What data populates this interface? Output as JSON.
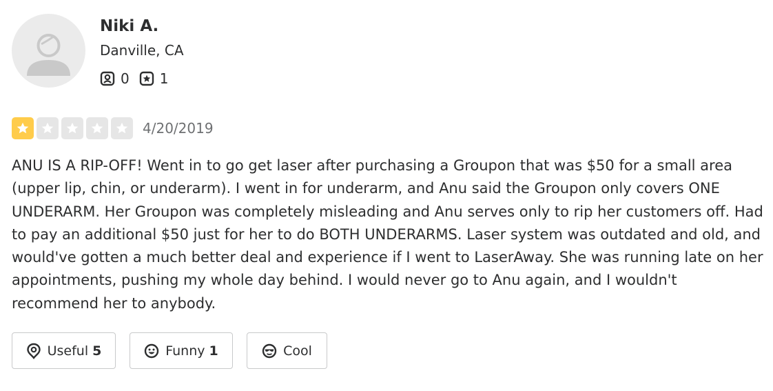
{
  "user": {
    "name": "Niki A.",
    "location": "Danville, CA",
    "friends_count": "0",
    "reviews_count": "1",
    "avatar_icon": "default-user-avatar-icon"
  },
  "review": {
    "rating": 1,
    "rating_max": 5,
    "date": "4/20/2019",
    "text": "ANU IS A RIP-OFF! Went in to go get laser after purchasing a Groupon that was $50 for a small area (upper lip, chin, or underarm). I went in for underarm, and Anu said the Groupon only covers ONE UNDERARM. Her Groupon was completely misleading and Anu serves only to rip her customers off. Had to pay an additional $50 just for her to do BOTH UNDERARMS. Laser system was outdated and old, and would've gotten a much better deal and experience if I went to LaserAway. She was running late on her appointments, pushing my whole day behind. I would never go to Anu again, and I wouldn't recommend her to anybody."
  },
  "actions": {
    "useful": {
      "label": "Useful",
      "count": "5",
      "icon": "lightbulb-icon"
    },
    "funny": {
      "label": "Funny",
      "count": "1",
      "icon": "smiley-icon"
    },
    "cool": {
      "label": "Cool",
      "count": "",
      "icon": "sunglasses-icon"
    }
  },
  "colors": {
    "star_on": "#ffcc4b",
    "star_off": "#e6e6e6",
    "text": "#2d2e2f",
    "muted": "#6e7072",
    "border": "#c8c9ca"
  }
}
